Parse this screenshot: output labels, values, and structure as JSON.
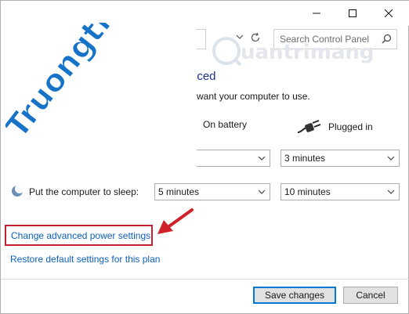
{
  "window": {
    "controls": {
      "minimize": "minimize-icon",
      "maximize": "maximize-icon",
      "close": "close-icon"
    }
  },
  "nav": {
    "search_placeholder": "Search Control Panel",
    "icons": [
      "chevron-down-icon",
      "refresh-icon",
      "search-icon"
    ]
  },
  "header": {
    "title_fragment": "nced",
    "subtitle_fragment": "u want your computer to use."
  },
  "columns": {
    "battery": "On battery",
    "plugged": "Plugged in",
    "plugged_icon": "power-plug-icon"
  },
  "settings": {
    "row1": {
      "battery_value": "",
      "plugged_value": "3 minutes"
    },
    "row2": {
      "label": "Put the computer to sleep:",
      "battery_value": "5 minutes",
      "plugged_value": "10 minutes",
      "icon": "moon-icon"
    }
  },
  "links": {
    "advanced": "Change advanced power settings",
    "restore": "Restore default settings for this plan"
  },
  "buttons": {
    "save": "Save changes",
    "cancel": "Cancel"
  },
  "watermarks": {
    "left": "Truongtin.top",
    "right": "uantrimang"
  },
  "colors": {
    "heading": "#1e3287",
    "link": "#0b5fbf",
    "highlight_box": "#c4202f",
    "arrow": "#d0202a",
    "watermark_blue": "#1673c8",
    "watermark_orange": "#f28a1c",
    "save_focus": "#0078d7"
  }
}
